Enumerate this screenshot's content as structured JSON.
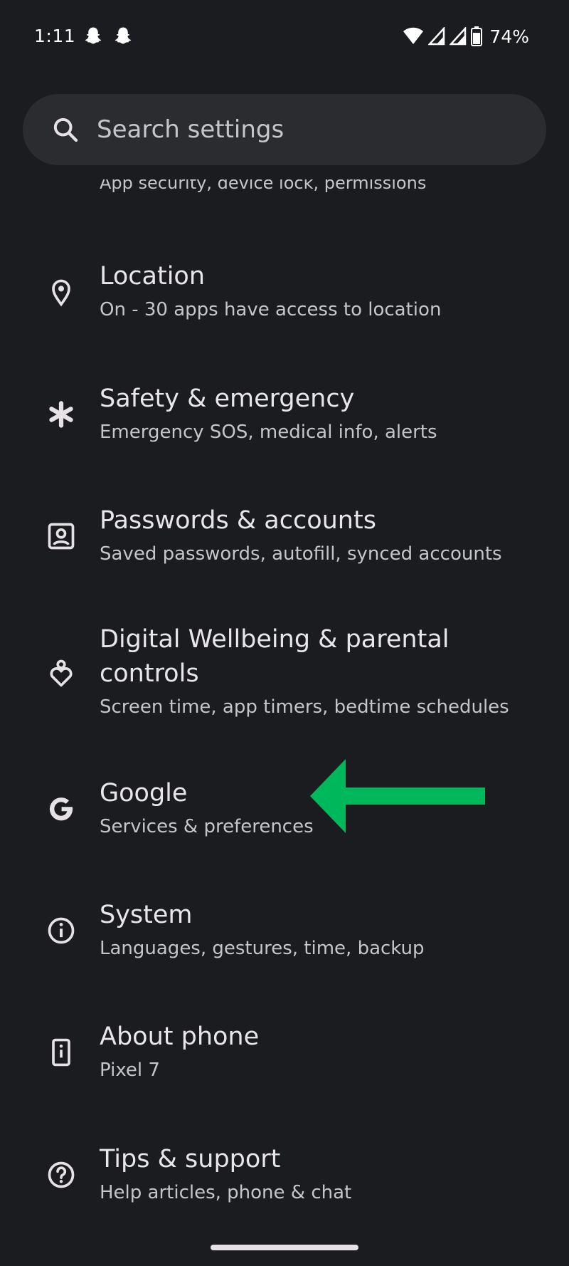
{
  "status_bar": {
    "time": "1:11",
    "battery": "74%",
    "icons": [
      "snapchat-icon",
      "snapchat-icon",
      "wifi-icon",
      "signal-icon",
      "signal-icon",
      "battery-icon"
    ]
  },
  "search": {
    "placeholder": "Search settings"
  },
  "clipped_item": {
    "subtitle": "App security, device lock, permissions"
  },
  "items": [
    {
      "title": "Location",
      "subtitle": "On - 30 apps have access to location",
      "icon": "location-pin-icon"
    },
    {
      "title": "Safety & emergency",
      "subtitle": "Emergency SOS, medical info, alerts",
      "icon": "asterisk-icon"
    },
    {
      "title": "Passwords & accounts",
      "subtitle": "Saved passwords, autofill, synced accounts",
      "icon": "account-box-icon"
    },
    {
      "title": "Digital Wellbeing & parental controls",
      "subtitle": "Screen time, app timers, bedtime schedules",
      "icon": "wellbeing-icon"
    },
    {
      "title": "Google",
      "subtitle": "Services & preferences",
      "icon": "google-g-icon"
    },
    {
      "title": "System",
      "subtitle": "Languages, gestures, time, backup",
      "icon": "info-icon"
    },
    {
      "title": "About phone",
      "subtitle": "Pixel 7",
      "icon": "phone-info-icon"
    },
    {
      "title": "Tips & support",
      "subtitle": "Help articles, phone & chat",
      "icon": "help-icon"
    }
  ],
  "annotation": {
    "arrow_color": "#00b85c"
  }
}
